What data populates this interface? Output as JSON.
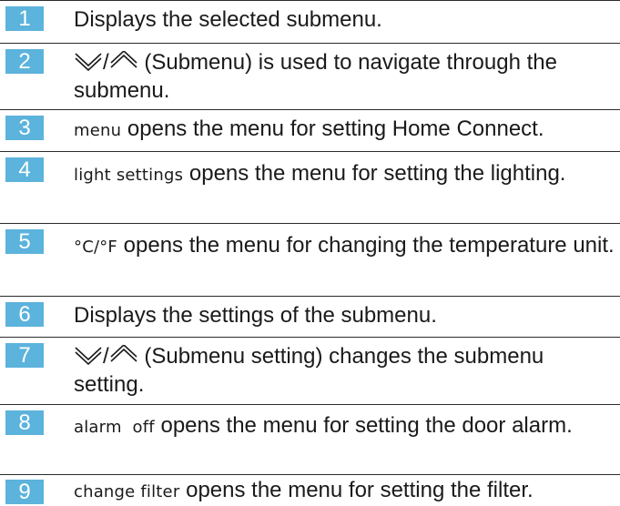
{
  "rows": [
    {
      "num": "1",
      "text": "Displays the selected submenu."
    },
    {
      "num": "2",
      "sep": "/",
      "text": " (Submenu) is used to navigate through the submenu."
    },
    {
      "num": "3",
      "key": "menu",
      "text": " opens the menu for setting Home Connect."
    },
    {
      "num": "4",
      "key": "light settings",
      "text": " opens the menu for setting the lighting."
    },
    {
      "num": "5",
      "key": "°C/°F",
      "text": " opens the menu for changing the temperature unit."
    },
    {
      "num": "6",
      "text": "Displays the settings of the submenu."
    },
    {
      "num": "7",
      "sep": "/",
      "text": " (Submenu setting) changes the submenu setting."
    },
    {
      "num": "8",
      "key": "alarm  off",
      "text": " opens the menu for setting the door alarm."
    },
    {
      "num": "9",
      "key": "change filter",
      "text": " opens the menu for setting the filter."
    }
  ],
  "colors": {
    "badge": "#5cb3dc",
    "rule": "#2b2b2b"
  },
  "icons": {
    "down": "chevron-double-down-icon",
    "up": "chevron-double-up-icon"
  }
}
